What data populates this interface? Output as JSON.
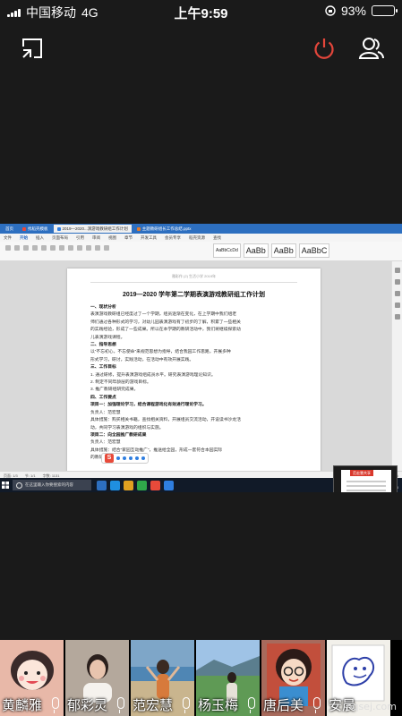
{
  "status_bar": {
    "carrier": "中国移动",
    "network": "4G",
    "time": "上午9:59",
    "battery": "93%",
    "battery_level": 0.93
  },
  "controls": {
    "minimize_icon": "shrink-window-icon",
    "end_icon": "power-icon",
    "participants_icon": "participants-icon",
    "end_color": "#e3463b"
  },
  "shared_screen": {
    "browser_tabs": [
      {
        "label": "找稻壳模板",
        "color": "#e84a3a"
      },
      {
        "label": "2019—2020...演游戏教研组工作计划",
        "color": "#2f7ee0"
      },
      {
        "label": "主题教研组长工作总结.pptx",
        "color": "#e07b2f"
      }
    ],
    "menu": [
      "文件",
      "开始",
      "插入",
      "页面布局",
      "引用",
      "审阅",
      "视图",
      "章节",
      "开发工具",
      "会员专享",
      "稻壳资源",
      "查找"
    ],
    "active_menu": "开始",
    "styles": [
      {
        "label": "AaBbCcDd",
        "size": "small"
      },
      {
        "label": "AaBb",
        "size": "big"
      },
      {
        "label": "AaBb",
        "size": "big"
      },
      {
        "label": "AaBbC",
        "size": "big"
      }
    ],
    "document": {
      "header": "雅彩作 (2) 生活小学 2019年",
      "title": "2019—2020 学年第二学期表演游戏教研组工作计划",
      "lines": [
        {
          "text": "一、现状分析",
          "heading": true
        },
        {
          "text": "表演游戏教研组已经度过了一个学期，组员逐渐在变化，在上学期中我们组老",
          "heading": false
        },
        {
          "text": "师们通过各种形式的学习，对幼儿园表演游戏有了初步的了解，积累了一些相关",
          "heading": false
        },
        {
          "text": "的实践经验，形成了一些成果。所以在本学期的教研活动中，我们将继续探索幼",
          "heading": false
        },
        {
          "text": "儿表演游戏课程。",
          "heading": false
        },
        {
          "text": "二、指导思想",
          "heading": true
        },
        {
          "text": "以“不忘初心，不忘使命”来规范思想为指导，结合我园工作思路，开展多种",
          "heading": false
        },
        {
          "text": "形式学习，研讨，实践活动，在活动中有效开展实践。",
          "heading": false
        },
        {
          "text": "三、工作目标",
          "heading": true
        },
        {
          "text": "1. 通过研修，提升表演游戏组成员水平。研究表演游戏理论知识。",
          "heading": false
        },
        {
          "text": "2. 制定不同年龄层的游戏目标。",
          "heading": false
        },
        {
          "text": "3. 推广教研组研究成果。",
          "heading": false
        },
        {
          "text": "四、工作要点",
          "heading": true
        },
        {
          "text": "项目一：加强理论学习，结合课程游戏化有效进行理论学习。",
          "heading": true
        },
        {
          "text": "负责人：范宏慧",
          "heading": false
        },
        {
          "text": "具体措施：购买相关书籍，查找相关资料，开展组员交流活动，开设读书沙龙活",
          "heading": false
        },
        {
          "text": "动，共同学习表演游戏的组织与实施。",
          "heading": false
        },
        {
          "text": "项目二：向全园推广教研成果",
          "heading": true
        },
        {
          "text": "负责人：范宏慧",
          "heading": false
        },
        {
          "text": "具体措施：结合“家园互动推广”，推送给全园，形成一套符合本园实际",
          "heading": false
        },
        {
          "text": "的教研资料。",
          "heading": false
        }
      ]
    },
    "status_line": {
      "page": "页面: 1/3",
      "section": "节: 1/1",
      "words": "字数: 1131",
      "zoom": "100%"
    },
    "taskbar": {
      "search_placeholder": "在这里输入你要搜索的内容",
      "clock_time": "9:59",
      "clock_date": "2020/2/13"
    },
    "thumbnail_label": "范宏慧共享"
  },
  "participants": [
    {
      "name": "黄麟雅",
      "bg": "#e8b8a8"
    },
    {
      "name": "郁彩灵",
      "bg": "#b4a89c"
    },
    {
      "name": "范宏慧",
      "bg": "#7ea6c8"
    },
    {
      "name": "杨玉梅",
      "bg": "#6f9a6c"
    },
    {
      "name": "唐后美",
      "bg": "#a86a5c"
    },
    {
      "name": "安晨",
      "bg": "#f2f0ea"
    }
  ],
  "watermark": "nqsej.com"
}
